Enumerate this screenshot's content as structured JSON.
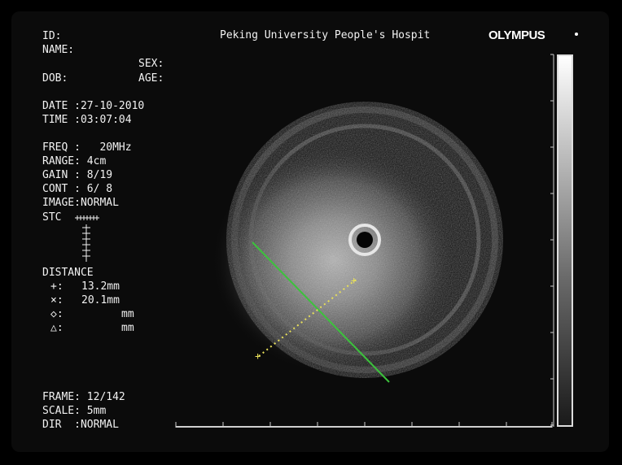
{
  "header": {
    "hospital": "Peking University People's Hospit",
    "brand": "OLYMPUS"
  },
  "patient": {
    "id_label": "ID:",
    "name_label": "NAME:",
    "sex_label": "SEX:",
    "dob_label": "DOB:",
    "age_label": "AGE:"
  },
  "session": {
    "date": "DATE :27-10-2010",
    "time": "TIME :03:07:04"
  },
  "settings": {
    "freq": "FREQ :   20MHz",
    "range": "RANGE: 4cm",
    "gain": "GAIN : 8/19",
    "cont": "CONT : 6/ 8",
    "image": "IMAGE:NORMAL",
    "stc": "STC"
  },
  "distance": {
    "title": "DISTANCE",
    "rows": [
      {
        "symbol": "+:",
        "value": "13.2mm"
      },
      {
        "symbol": "×:",
        "value": "20.1mm"
      },
      {
        "symbol": "◇:",
        "value": "mm"
      },
      {
        "symbol": "△:",
        "value": "mm"
      }
    ]
  },
  "footer": {
    "frame": "FRAME: 12/142",
    "scale": "SCALE: 5mm",
    "dir": "DIR  :NORMAL"
  },
  "colors": {
    "measure_plus": "#e8e05a",
    "measure_line": "#3cc23c",
    "text": "#f2f2f2"
  }
}
